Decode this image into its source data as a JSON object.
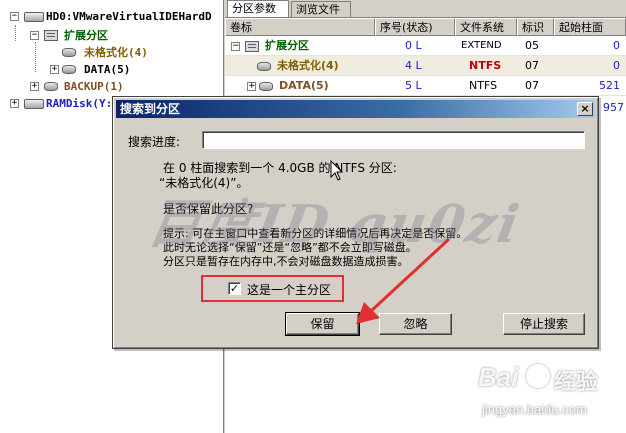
{
  "tree": {
    "disk0": "HD0:VMwareVirtualIDEHardD",
    "extended": "扩展分区",
    "unformatted": "未格式化(4)",
    "data": "DATA(5)",
    "backup": "BACKUP(1)",
    "ramdisk": "RAMDisk(Y:"
  },
  "tabs": [
    {
      "label": "分区参数"
    },
    {
      "label": "浏览文件"
    }
  ],
  "table": {
    "headers": [
      "卷标",
      "序号(状态)",
      "文件系统",
      "标识",
      "起始柱面"
    ],
    "rows": [
      {
        "label": "扩展分区",
        "seq": "0 L",
        "fs": "EXTEND",
        "id": "05",
        "start": "0"
      },
      {
        "label": "未格式化(4)",
        "seq": "4 L",
        "fs": "NTFS",
        "id": "07",
        "start": "0"
      },
      {
        "label": "DATA(5)",
        "seq": "5 L",
        "fs": "NTFS",
        "id": "07",
        "start": "521"
      }
    ],
    "partial_value": "957"
  },
  "dialog": {
    "title": "搜索到分区",
    "close": "×",
    "progress_label": "搜索进度:",
    "message_line1": "在 0 柱面搜索到一个 4.0GB 的 NTFS 分区:",
    "message_line2": "“未格式化(4)”。",
    "question": "是否保留此分区?",
    "hint_line1": "提示: 可在主窗口中查看新分区的详细情况后再决定是否保留。",
    "hint_line2": "此时无论选择“保留”还是“忽略”都不会立即写磁盘。",
    "hint_line3": "分区只是暂存在内存中,不会对磁盘数据造成损害。",
    "checkbox_label": "这是一个主分区",
    "checkbox_mark": "✓",
    "keep": "保留",
    "ignore": "忽略",
    "stop": "停止搜索"
  },
  "watermark": "百度ID qu0zi",
  "baidu": {
    "brand": "Bai",
    "brand2": "经验",
    "url": "jingyan.baidu.com"
  },
  "colors": {
    "annotation_red": "#e03030",
    "title_start": "#0a246a",
    "title_end": "#a6caf0"
  }
}
